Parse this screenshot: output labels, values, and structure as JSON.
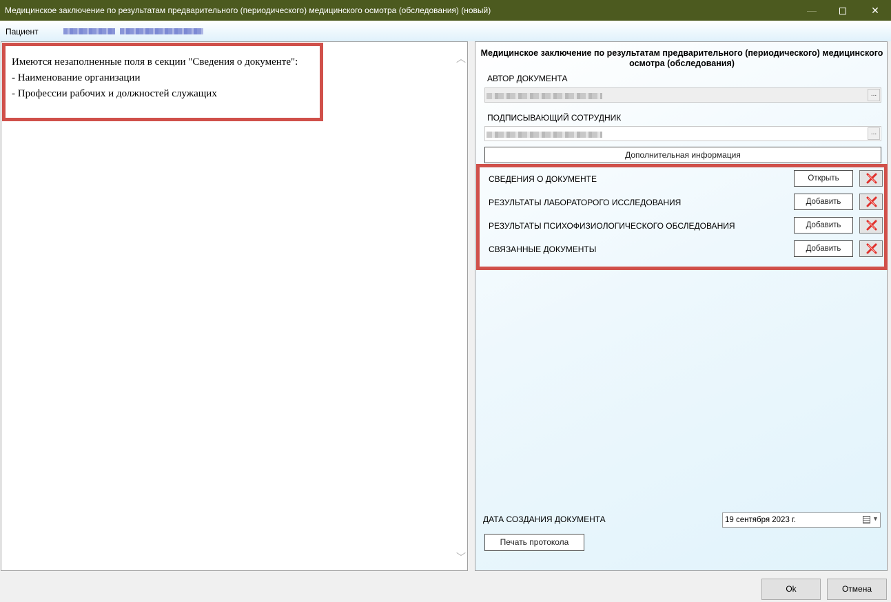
{
  "window": {
    "title": "Медицинское заключение по результатам предварительного (периодического) медицинского осмотра (обследования) (новый)",
    "minimize_icon": "minimize-icon",
    "maximize_icon": "maximize-icon",
    "close_glyph": "✕"
  },
  "patient": {
    "label": "Пациент"
  },
  "validation": {
    "line1": "Имеются незаполненные поля в секции \"Сведения о документе\":",
    "line2": "- Наименование организации",
    "line3": "- Профессии рабочих и должностей служащих",
    "border_color": "#d0504a"
  },
  "form": {
    "title": "Медицинское заключение по результатам предварительного (периодического) медицинского осмотра (обследования)",
    "author_label": "АВТОР ДОКУМЕНТА",
    "signer_label": "ПОДПИСЫВАЮЩИЙ СОТРУДНИК",
    "dots": "...",
    "additional_info_button": "Дополнительная информация",
    "sections": [
      {
        "label": "СВЕДЕНИЯ О ДОКУМЕНТЕ",
        "button": "Открыть",
        "delete_icon": "delete-x-icon"
      },
      {
        "label": "РЕЗУЛЬТАТЫ ЛАБОРАТОРОГО ИССЛЕДОВАНИЯ",
        "button": "Добавить",
        "delete_icon": "delete-x-icon"
      },
      {
        "label": "РЕЗУЛЬТАТЫ ПСИХОФИЗИОЛОГИЧЕСКОГО ОБСЛЕДОВАНИЯ",
        "button": "Добавить",
        "delete_icon": "delete-x-icon"
      },
      {
        "label": "СВЯЗАННЫЕ ДОКУМЕНТЫ",
        "button": "Добавить",
        "delete_icon": "delete-x-icon"
      }
    ],
    "date_label": "ДАТА СОЗДАНИЯ ДОКУМЕНТА",
    "date_value": "19 сентября 2023 г.",
    "print_button": "Печать протокола"
  },
  "footer": {
    "ok_button": "Ok",
    "cancel_button": "Отмена"
  },
  "colors": {
    "titlebar": "#4c5a1f",
    "highlight": "#d0504a",
    "delete_icon": "#e0302c"
  }
}
